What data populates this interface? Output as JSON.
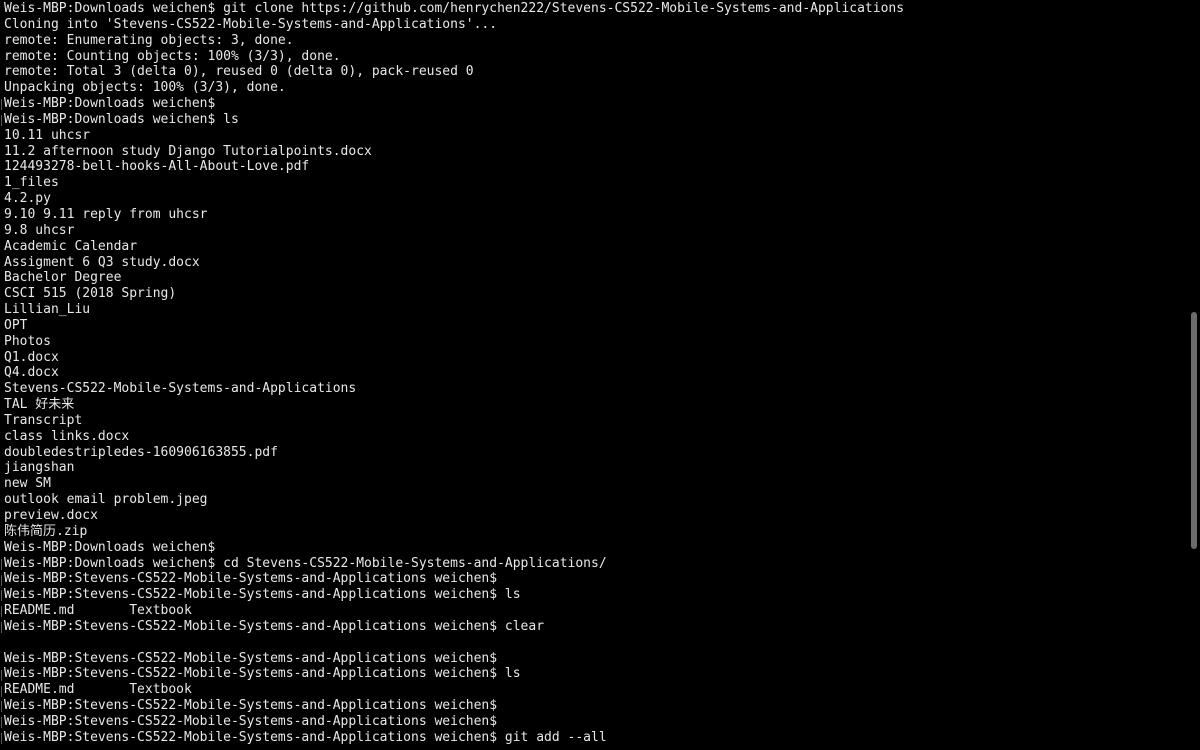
{
  "terminal": {
    "lines": [
      "Weis-MBP:Downloads weichen$ git clone https://github.com/henrychen222/Stevens-CS522-Mobile-Systems-and-Applications",
      "Cloning into 'Stevens-CS522-Mobile-Systems-and-Applications'...",
      "remote: Enumerating objects: 3, done.",
      "remote: Counting objects: 100% (3/3), done.",
      "remote: Total 3 (delta 0), reused 0 (delta 0), pack-reused 0",
      "Unpacking objects: 100% (3/3), done.",
      "Weis-MBP:Downloads weichen$",
      "Weis-MBP:Downloads weichen$ ls",
      "10.11 uhcsr",
      "11.2 afternoon study Django Tutorialpoints.docx",
      "124493278-bell-hooks-All-About-Love.pdf",
      "1_files",
      "4.2.py",
      "9.10 9.11 reply from uhcsr",
      "9.8 uhcsr",
      "Academic Calendar",
      "Assigment 6 Q3 study.docx",
      "Bachelor Degree",
      "CSCI 515 (2018 Spring)",
      "Lillian_Liu",
      "OPT",
      "Photos",
      "Q1.docx",
      "Q4.docx",
      "Stevens-CS522-Mobile-Systems-and-Applications",
      "TAL 好未来",
      "Transcript",
      "class links.docx",
      "doubledestripledes-160906163855.pdf",
      "jiangshan",
      "new SM",
      "outlook email problem.jpeg",
      "preview.docx",
      "陈伟简历.zip",
      "Weis-MBP:Downloads weichen$",
      "Weis-MBP:Downloads weichen$ cd Stevens-CS522-Mobile-Systems-and-Applications/",
      "Weis-MBP:Stevens-CS522-Mobile-Systems-and-Applications weichen$",
      "Weis-MBP:Stevens-CS522-Mobile-Systems-and-Applications weichen$ ls",
      "README.md       Textbook",
      "Weis-MBP:Stevens-CS522-Mobile-Systems-and-Applications weichen$ clear",
      "",
      "Weis-MBP:Stevens-CS522-Mobile-Systems-and-Applications weichen$",
      "Weis-MBP:Stevens-CS522-Mobile-Systems-and-Applications weichen$ ls",
      "README.md       Textbook",
      "Weis-MBP:Stevens-CS522-Mobile-Systems-and-Applications weichen$",
      "Weis-MBP:Stevens-CS522-Mobile-Systems-and-Applications weichen$",
      "Weis-MBP:Stevens-CS522-Mobile-Systems-and-Applications weichen$ git add --all"
    ]
  },
  "colors": {
    "background": "#000000",
    "foreground": "#e8e8e8",
    "scrollbar_thumb": "#6b6b6b"
  }
}
